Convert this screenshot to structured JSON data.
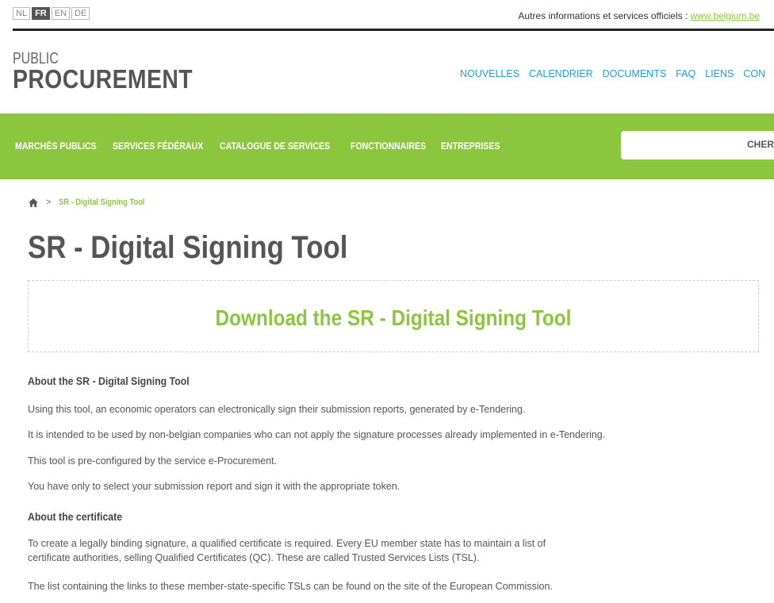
{
  "languages": [
    "NL",
    "FR",
    "EN",
    "DE"
  ],
  "active_language": "FR",
  "official": {
    "label": "Autres informations et services officiels : ",
    "link": "www.belgium.be"
  },
  "brand": {
    "small": "PUBLIC",
    "big": "PROCUREMENT"
  },
  "topnav": [
    "NOUVELLES",
    "CALENDRIER",
    "DOCUMENTS",
    "FAQ",
    "LIENS",
    "CON"
  ],
  "greennav": [
    "MARCHÉS PUBLICS",
    "SERVICES FÉDÉRAUX",
    "CATALOGUE DE SERVICES",
    "FONCTIONNAIRES",
    "ENTREPRISES"
  ],
  "search": {
    "button": "CHER"
  },
  "breadcrumb": {
    "separator": ">",
    "current": "SR - Digital Signing Tool"
  },
  "page_title": "SR - Digital Signing Tool",
  "download_link": "Download the SR - Digital Signing Tool",
  "section1": {
    "heading": "About the SR - Digital Signing Tool",
    "paragraphs": [
      "Using this tool, an economic operators can electronically sign their submission reports, generated by e-Tendering.",
      "It is intended to be used by non-belgian companies who can not apply the signature processes already implemented in e-Tendering.",
      "This tool is pre-configured by the service e-Procurement.",
      "You have only to select your submission report and sign it with the appropriate token."
    ]
  },
  "section2": {
    "heading": "About the certificate",
    "paragraphs": [
      "To create a legally binding signature, a qualified certificate is required. Every EU member state has to maintain a list of certificate authorities, selling Qualified Certificates (QC). These are called Trusted Services Lists (TSL).",
      "The list containing the links to these member-state-specific TSLs can be found on the site of the European Commission."
    ]
  },
  "colors": {
    "accent": "#8cc63f",
    "link_blue": "#1a9fcf",
    "text": "#555555"
  }
}
